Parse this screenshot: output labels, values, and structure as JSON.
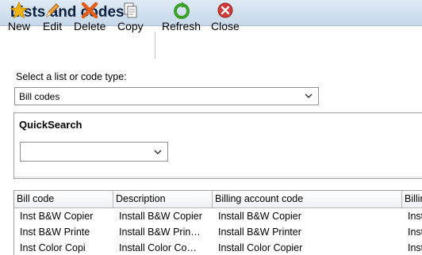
{
  "window": {
    "title": "Lists and codes"
  },
  "toolbar": {
    "buttons": [
      {
        "label": "New",
        "icon": "star-icon"
      },
      {
        "label": "Edit",
        "icon": "pencil-icon"
      },
      {
        "label": "Delete",
        "icon": "delete-x-icon"
      },
      {
        "label": "Copy",
        "icon": "copy-icon"
      },
      {
        "label": "Refresh",
        "icon": "refresh-icon"
      },
      {
        "label": "Close",
        "icon": "close-icon"
      }
    ]
  },
  "selector": {
    "label": "Select a list or code type:",
    "value": "Bill codes"
  },
  "quicksearch": {
    "title": "QuickSearch",
    "value": ""
  },
  "table": {
    "columns": [
      "Bill code",
      "Description",
      "Billing account code",
      "Billin"
    ],
    "rows": [
      [
        "Inst B&W Copier",
        "Install B&W Copier",
        "Install B&W Copier",
        "Inst"
      ],
      [
        "Inst B&W Printe",
        "Install B&W Prin…",
        "Install B&W Printer",
        "Inst"
      ],
      [
        "Inst Color Copi",
        "Install Color Co…",
        "Install Color Copier",
        "Inst"
      ]
    ]
  },
  "colors": {
    "accent": "#1f5fa8",
    "titlebar": "#cfdff0",
    "star": "#f2b411",
    "delete": "#e45d16",
    "refresh": "#3aa027",
    "close": "#d23c3c"
  }
}
